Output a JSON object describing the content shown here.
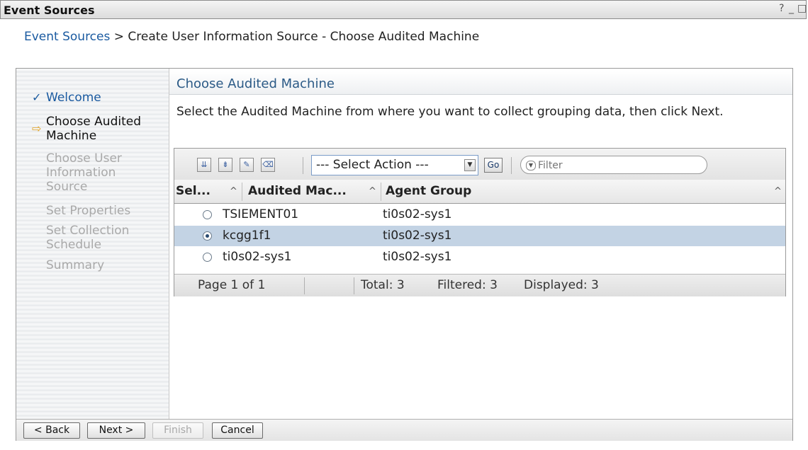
{
  "window": {
    "title": "Event Sources",
    "controls": [
      "?",
      "_",
      "□"
    ]
  },
  "breadcrumb": {
    "link": "Event Sources",
    "separator": ">",
    "current": "Create User Information Source - Choose Audited Machine"
  },
  "wizard": {
    "steps": [
      {
        "label": "Welcome",
        "state": "done"
      },
      {
        "label": "Choose Audited Machine",
        "state": "current"
      },
      {
        "label": "Choose User Information Source",
        "state": "future"
      },
      {
        "label": "Set Properties",
        "state": "future"
      },
      {
        "label": "Set Collection Schedule",
        "state": "future"
      },
      {
        "label": "Summary",
        "state": "future"
      }
    ],
    "step_labels": {
      "welcome": "Welcome",
      "choose_audited_1": "Choose Audited",
      "choose_audited_2": "Machine",
      "choose_user_1": "Choose User",
      "choose_user_2": "Information",
      "choose_user_3": "Source",
      "set_properties": "Set Properties",
      "set_collection_1": "Set Collection",
      "set_collection_2": "Schedule",
      "summary": "Summary"
    },
    "step_icons": {
      "done": "checkmark-icon",
      "current": "arrow-right-icon"
    }
  },
  "content": {
    "heading": "Choose Audited Machine",
    "instructions": "Select the Audited Machine from where you want to collect grouping data, then click Next."
  },
  "table": {
    "toolbar": {
      "icons": [
        "select-all-icon",
        "deselect-all-icon",
        "edit-sort-icon",
        "clear-sort-icon"
      ],
      "action_select": "--- Select Action ---",
      "go_label": "Go",
      "filter_placeholder": "Filter"
    },
    "columns": [
      {
        "label": "Sel...",
        "sort": "^"
      },
      {
        "label": "Audited Mac...",
        "sort": "^"
      },
      {
        "label": "Agent Group",
        "sort": "^"
      }
    ],
    "rows": [
      {
        "selected": false,
        "machine": "TSIEMENT01",
        "group": "ti0s02-sys1"
      },
      {
        "selected": true,
        "machine": "kcgg1f1",
        "group": "ti0s02-sys1"
      },
      {
        "selected": false,
        "machine": "ti0s02-sys1",
        "group": "ti0s02-sys1"
      }
    ],
    "footer": {
      "page": "Page 1 of 1",
      "total": "Total: 3",
      "filtered": "Filtered: 3",
      "displayed": "Displayed: 3"
    }
  },
  "buttons": {
    "back": "< Back",
    "next": "Next >",
    "finish": "Finish",
    "cancel": "Cancel"
  },
  "colors": {
    "link": "#1a5aa0",
    "heading": "#2b5a86",
    "selected_row": "#c3d3e4",
    "disabled_text": "#a9a9a9"
  }
}
